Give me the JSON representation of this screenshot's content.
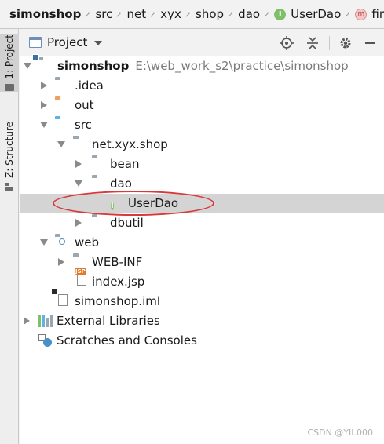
{
  "breadcrumb": [
    "simonshop",
    "src",
    "net",
    "xyx",
    "shop",
    "dao",
    "UserDao",
    "fir"
  ],
  "side_tabs": [
    "1: Project",
    "Z: Structure"
  ],
  "panel": {
    "title": "Project"
  },
  "tree": [
    {
      "label": "simonshop",
      "path": "E:\\web_work_s2\\practice\\simonshop"
    },
    {
      "label": ".idea"
    },
    {
      "label": "out"
    },
    {
      "label": "src"
    },
    {
      "label": "net.xyx.shop"
    },
    {
      "label": "bean"
    },
    {
      "label": "dao"
    },
    {
      "label": "UserDao"
    },
    {
      "label": "dbutil"
    },
    {
      "label": "web"
    },
    {
      "label": "WEB-INF"
    },
    {
      "label": "index.jsp"
    },
    {
      "label": "simonshop.iml"
    },
    {
      "label": "External Libraries"
    },
    {
      "label": "Scratches and Consoles"
    }
  ],
  "icons": {
    "interface_glyph": "I",
    "method_glyph": "m",
    "jsp_tag": "JSP"
  },
  "colors": {
    "interface_green": "#7fbf6a",
    "highlight_red": "#d8393b",
    "folder_orange": "#f0a05a",
    "folder_blue": "#5db3e8",
    "selection": "#d4d4d4"
  },
  "watermark": "CSDN @YII.000"
}
